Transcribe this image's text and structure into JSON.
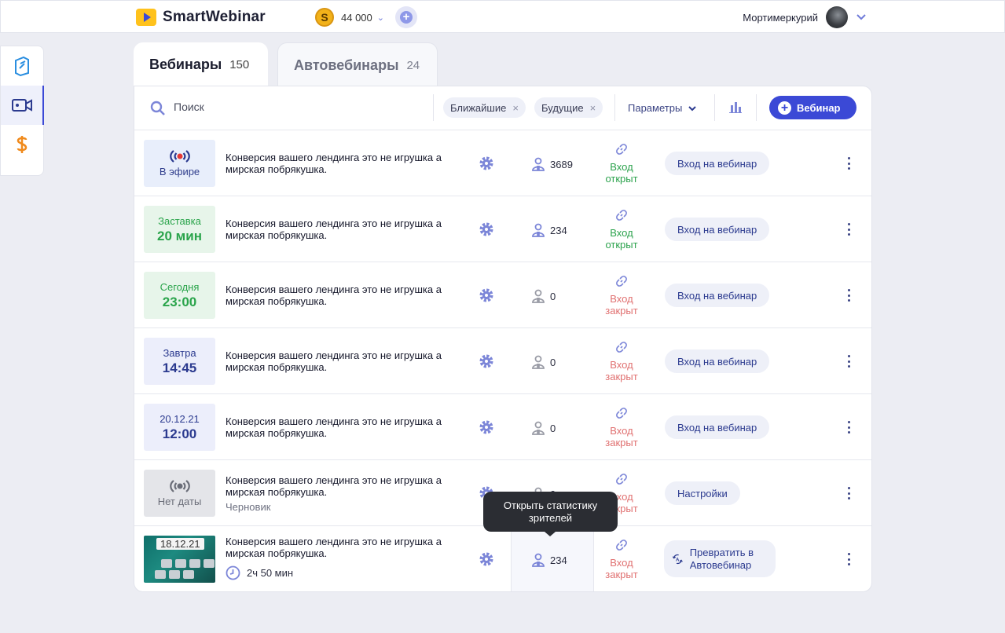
{
  "app": {
    "name": "SmartWebinar",
    "balance": "44 000",
    "coin_symbol": "S",
    "user_name": "Мортимеркурий"
  },
  "sidebar": {
    "items": [
      {
        "name": "courses-icon",
        "active": false
      },
      {
        "name": "video-camera-icon",
        "active": true
      },
      {
        "name": "dollar-icon",
        "active": false
      }
    ]
  },
  "tabs": [
    {
      "label": "Вебинары",
      "count": "150",
      "active": true
    },
    {
      "label": "Автовебинары",
      "count": "24",
      "active": false
    }
  ],
  "toolbar": {
    "search_placeholder": "Поиск",
    "filters": [
      "Ближайшие",
      "Будущие"
    ],
    "filter_remove": "×",
    "params_label": "Параметры",
    "add_label": "Вебинар"
  },
  "rows": [
    {
      "status_line1": "В эфире",
      "status_kind": "live",
      "title": "Конверсия вашего лендинга это не игрушка а мирская побрякушка.",
      "viewers": "3689",
      "link_line1": "Вход",
      "link_line2": "открыт",
      "link_open": true,
      "action": "Вход на вебинар"
    },
    {
      "status_line1": "Заставка",
      "status_line2": "20 мин",
      "status_kind": "green",
      "title": "Конверсия вашего лендинга это не игрушка а мирская побрякушка.",
      "viewers": "234",
      "link_line1": "Вход",
      "link_line2": "открыт",
      "link_open": true,
      "action": "Вход на вебинар"
    },
    {
      "status_line1": "Сегодня",
      "status_line2": "23:00",
      "status_kind": "green",
      "title": "Конверсия вашего лендинга это не игрушка а мирская побрякушка.",
      "viewers": "0",
      "link_line1": "Вход",
      "link_line2": "закрыт",
      "link_open": false,
      "action": "Вход на вебинар"
    },
    {
      "status_line1": "Завтра",
      "status_line2": "14:45",
      "status_kind": "blue",
      "title": "Конверсия вашего лендинга это не игрушка а мирская побрякушка.",
      "viewers": "0",
      "link_line1": "Вход",
      "link_line2": "закрыт",
      "link_open": false,
      "action": "Вход на вебинар"
    },
    {
      "status_line1": "20.12.21",
      "status_line2": "12:00",
      "status_kind": "blue",
      "title": "Конверсия вашего лендинга это не игрушка а мирская побрякушка.",
      "viewers": "0",
      "link_line1": "Вход",
      "link_line2": "закрыт",
      "link_open": false,
      "action": "Вход на вебинар"
    },
    {
      "status_line1": "Нет даты",
      "status_kind": "gray",
      "title": "Конверсия вашего лендинга это не игрушка а мирская побрякушка.",
      "subtitle": "Черновик",
      "viewers": "0",
      "link_line1": "Вход",
      "link_line2": "закрыт",
      "link_open": false,
      "action": "Настройки"
    },
    {
      "thumb_date": "18.12.21",
      "title": "Конверсия вашего лендинга это не игрушка а мирская побрякушка.",
      "duration": "2ч 50 мин",
      "viewers": "234",
      "link_line1": "Вход",
      "link_line2": "закрыт",
      "link_open": false,
      "action": "Превратить в Автовебинар"
    }
  ],
  "tooltip": "Открыть статистику зрителей",
  "colors": {
    "accent": "#3b49d6",
    "open": "#2ba24c",
    "closed": "#e07070",
    "live_dot": "#e53935"
  }
}
